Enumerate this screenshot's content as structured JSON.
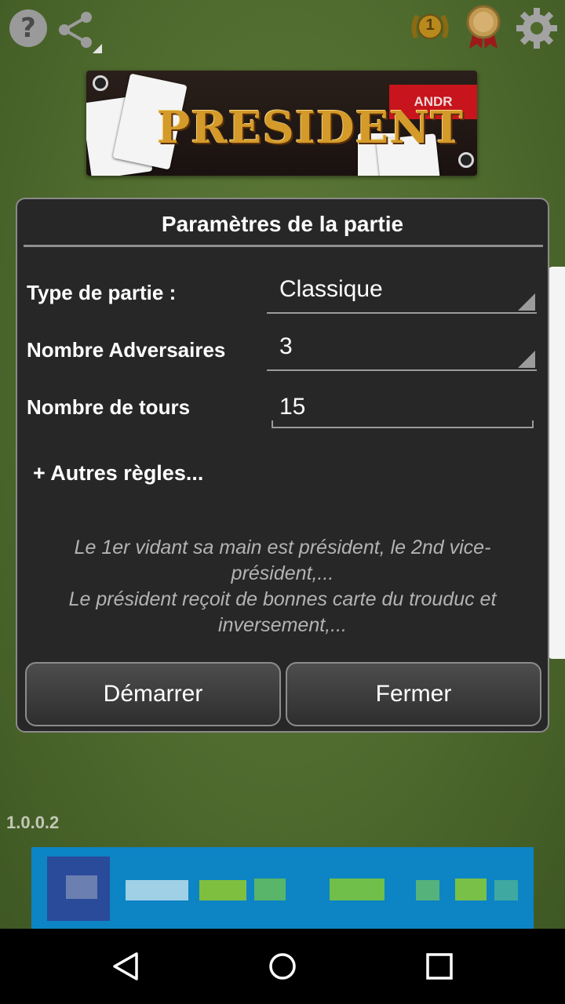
{
  "colors": {
    "felt": "#4e6a2d",
    "dialog_bg": "#272727",
    "accent_red": "#c8141c",
    "ad_blue": "#0d84c4"
  },
  "toolbar": {
    "help_icon": "question-circle",
    "help_glyph": "?",
    "share_icon": "share",
    "achievement_badge_number": "1",
    "achievement_icon": "laurel-medal",
    "award_icon": "ribbon-medal",
    "settings_icon": "gear"
  },
  "logo": {
    "title": "PRESIDENT",
    "ribbon_text": "ANDR"
  },
  "dialog": {
    "title": "Paramètres de la partie",
    "game_type": {
      "label": "Type de partie :",
      "value": "Classique"
    },
    "opponents": {
      "label": "Nombre Adversaires",
      "value": "3"
    },
    "rounds": {
      "label": "Nombre de tours",
      "value": "15"
    },
    "more_rules": "+ Autres règles...",
    "description_line1": "Le 1er vidant sa main est président, le 2nd vice-président,...",
    "description_line2": "Le président reçoit de bonnes carte du trouduc et inversement,...",
    "start_button": "Démarrer",
    "close_button": "Fermer"
  },
  "version": "1.0.0.2",
  "navbar": {
    "back_icon": "triangle-back",
    "home_icon": "circle-home",
    "recents_icon": "square-recents"
  }
}
